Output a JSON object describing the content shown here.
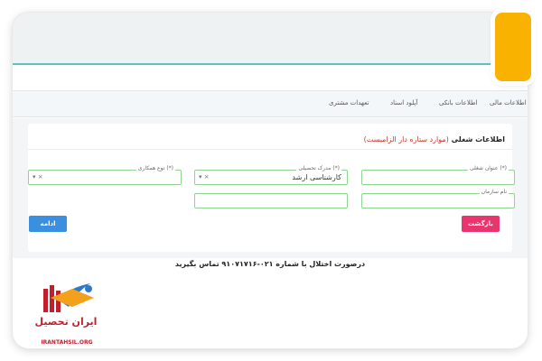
{
  "tabs": [
    {
      "label": "اطلاعات مالی"
    },
    {
      "label": "اطلاعات بانکی"
    },
    {
      "label": "آپلود اسناد"
    },
    {
      "label": "تعهدات مشتری"
    }
  ],
  "form": {
    "title": "اطلاعات شغلی",
    "required_note": "(موارد ستاره دار الزامیست)",
    "fields": {
      "job_title": {
        "label": "عنوان شغلی (*)",
        "value": ""
      },
      "education": {
        "label": "مدرک تحصیلی (*)",
        "value": "کارشناسی ارشد",
        "clear_icon": "×",
        "arrow_icon": "▾"
      },
      "employment_type": {
        "label": "نوع همکاری (*)",
        "value": "",
        "clear_icon": "×",
        "arrow_icon": "▾"
      },
      "organization": {
        "label": "نام سازمان",
        "value": ""
      },
      "extra": {
        "label": "",
        "value": ""
      }
    },
    "buttons": {
      "back": "بازگشت",
      "continue": "ادامه"
    }
  },
  "notice": "درصورت اختلال با شماره ۰۲۱-۹۱۰۷۱۷۱۶ تماس بگیرید",
  "logo": {
    "fa": "ایران تحصیل",
    "en": "IRANTAHSIL.ORG"
  },
  "colors": {
    "accent_teal": "#5cc3b8",
    "orange": "#f9b200",
    "back_button": "#e8356e",
    "continue_button": "#3a8fe0",
    "field_border": "#8fd48f",
    "brand_red": "#c21f2d"
  }
}
